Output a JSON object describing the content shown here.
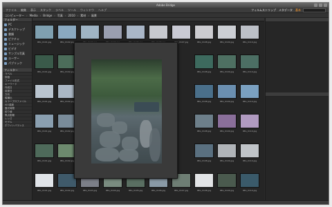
{
  "window": {
    "title": "Adobe Bridge"
  },
  "menubar": {
    "menus": [
      "ファイル",
      "編集",
      "表示",
      "スタック",
      "ラベル",
      "ツール",
      "ウィンドウ",
      "ヘルプ"
    ],
    "workspaces": [
      {
        "label": "フィルムストリップ",
        "active": false
      },
      {
        "label": "メタデータ",
        "active": false
      },
      {
        "label": "基本",
        "active": true
      }
    ],
    "search_placeholder": ""
  },
  "pathbar": {
    "crumbs": [
      "コンピューター",
      "Media",
      "Bridge",
      "写真",
      "2010",
      "素材",
      "風景"
    ]
  },
  "left_panel": {
    "tabs": [
      "フォルダー",
      "お気に入り"
    ],
    "favorites": [
      {
        "label": "PC",
        "icon": "computer-icon"
      },
      {
        "label": "デスクトップ",
        "icon": "desktop-icon"
      },
      {
        "label": "書類",
        "icon": "folder-icon"
      },
      {
        "label": "ピクチャ",
        "icon": "folder-icon"
      },
      {
        "label": "ミュージック",
        "icon": "folder-icon"
      },
      {
        "label": "ビデオ",
        "icon": "folder-icon"
      },
      {
        "label": "サンプル写真",
        "icon": "folder-icon"
      },
      {
        "label": "ユーザー",
        "icon": "folder-icon"
      },
      {
        "label": "パブリック",
        "icon": "folder-icon"
      }
    ],
    "filter_title": "フィルター",
    "filter_rows": [
      "ラベル",
      "評価",
      "ファイル形式",
      "キーワード",
      "作成日",
      "変更日",
      "方向",
      "縦横比",
      "カラープロファイル",
      "ISO感度",
      "露光時間",
      "絞り値",
      "焦点距離",
      "レンズ",
      "モデル",
      "ホワイトバランス"
    ]
  },
  "thumbnails": {
    "grid": [
      [
        "#7fa0b0",
        "#8aa9c0",
        "#9fb4c4",
        "#9a9fb0",
        "#a9b6c7",
        "#c7c9cf",
        "#c9cad4",
        "#ccccd0",
        "#cccfd4",
        "#bcc0c7",
        "#4f5f5a",
        "#6f7f8a"
      ],
      [
        "#3a5a4a",
        "#4c6d5a",
        "",
        "",
        "",
        "",
        "",
        "#3d6a5e",
        "#4e7062",
        "#4c6f64",
        "#4f7262",
        "#3d5a4e"
      ],
      [
        "#b9c4cf",
        "#aab7c4",
        "",
        "",
        "",
        "",
        "",
        "#4a6f8a",
        "#6b8fb0",
        "#7aa0c0",
        "#3d5a7a",
        "#4d6f8c"
      ],
      [
        "#8a9fb0",
        "#7a8c9a",
        "",
        "",
        "",
        "",
        "",
        "#6d7f8a",
        "#8a6f9a",
        "#b09ac0",
        "#7f9c80",
        "#5a6f5c"
      ],
      [
        "#4e6a5a",
        "#6d8a6e",
        "",
        "",
        "",
        "",
        "",
        "#5a7080",
        "#b0b4b8",
        "#c0c4c8",
        "#3f5a48",
        "#5e7a6c"
      ],
      [
        "#e0e4e8",
        "#3f5a6a",
        "#7c7f88",
        "#7a8c80",
        "#5a6f62",
        "#8a9aa6",
        "#6e7e74",
        "#e2e4e6",
        "#4a5a4e",
        "#3a5a6a",
        "#2f6a8a",
        "#7a8a9a"
      ]
    ],
    "labels": [
      "IMG_0101.jpg",
      "IMG_0102.jpg",
      "IMG_0103.jpg",
      "IMG_0104.jpg",
      "IMG_0105.jpg",
      "IMG_0106.jpg",
      "IMG_0107.jpg",
      "IMG_0108.jpg",
      "IMG_0109.jpg",
      "IMG_0110.jpg",
      "IMG_0111.jpg",
      "IMG_0112.jpg"
    ]
  },
  "colors": {
    "accent": "#ff9a2a",
    "panel": "#2f2f2f",
    "content": "#252525"
  }
}
